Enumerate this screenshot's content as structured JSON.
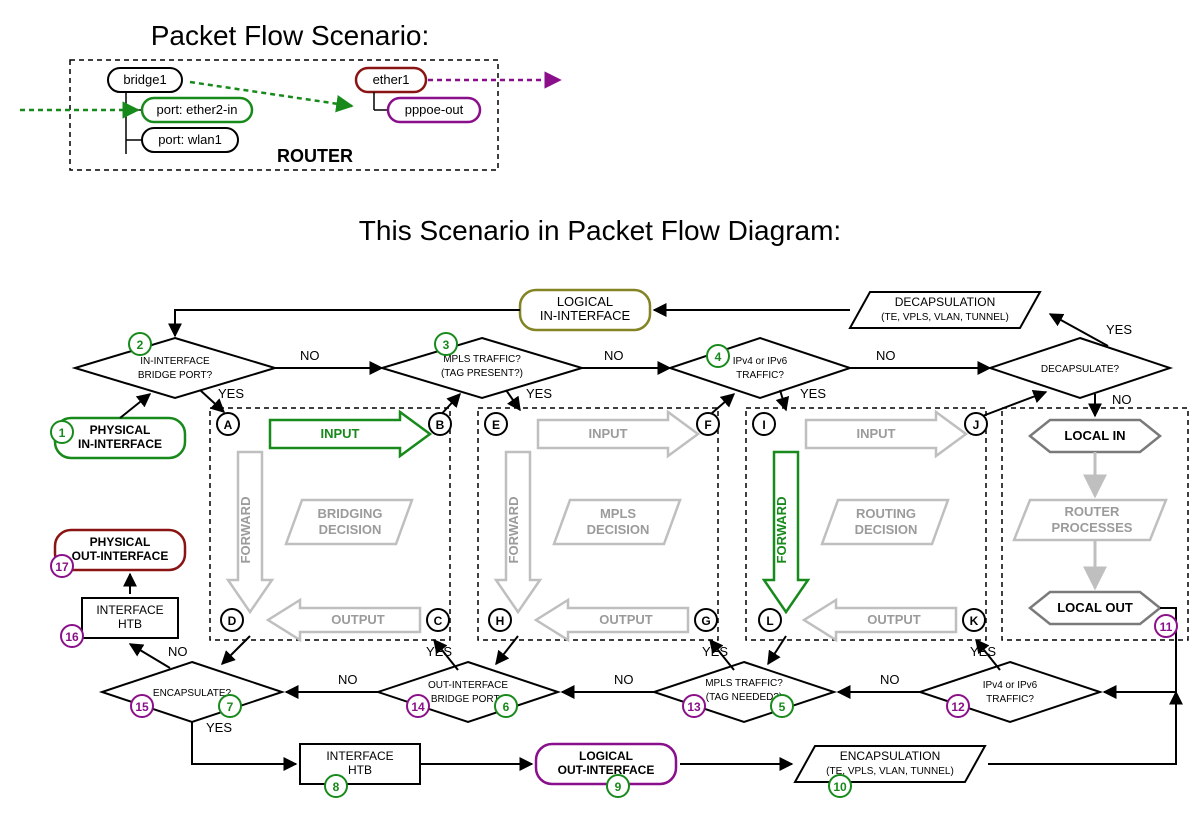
{
  "top_title": "Packet Flow Scenario:",
  "main_title": "This Scenario in Packet Flow Diagram:",
  "router_label": "ROUTER",
  "scenario": {
    "bridge": "bridge1",
    "p1": "port: ether2-in",
    "p2": "port: wlan1",
    "e1": "ether1",
    "pppoe": "pppoe-out"
  },
  "nodes": {
    "phys_in": "PHYSICAL\nIN-INTERFACE",
    "log_in": "LOGICAL\nIN-INTERFACE",
    "decap": "DECAPSULATION\n(TE, VPLS, VLAN, TUNNEL)",
    "d1": "IN-INTERFACE\nBRIDGE PORT?",
    "d2": "MPLS TRAFFIC?",
    "d2s": "(TAG PRESENT?)",
    "d3": "IPv4 or IPv6\nTRAFFIC?",
    "d4": "DECAPSULATE?",
    "bridging": "BRIDGING\nDECISION",
    "mpls": "MPLS\nDECISION",
    "routing": "ROUTING\nDECISION",
    "input": "INPUT",
    "forward": "FORWARD",
    "output": "OUTPUT",
    "local_in": "LOCAL IN",
    "router_proc": "ROUTER\nPROCESSES",
    "local_out": "LOCAL OUT",
    "d5": "IPv4 or IPv6\nTRAFFIC?",
    "d6": "MPLS TRAFFIC?",
    "d6s": "(TAG NEEDED?)",
    "d7": "OUT-INTERFACE\nBRIDGE PORT?",
    "d8": "ENCAPSULATE?",
    "encap": "ENCAPSULATION\n(TE, VPLS, VLAN, TUNNEL)",
    "htb": "INTERFACE\nHTB",
    "htb2": "INTERFACE\nHTB",
    "log_out": "LOGICAL\nOUT-INTERFACE",
    "phys_out": "PHYSICAL\nOUT-INTERFACE"
  },
  "yes": "YES",
  "no": "NO",
  "letters": [
    "A",
    "B",
    "C",
    "D",
    "E",
    "F",
    "G",
    "H",
    "I",
    "J",
    "K",
    "L"
  ],
  "nums": [
    "1",
    "2",
    "3",
    "4",
    "5",
    "6",
    "7",
    "8",
    "9",
    "10",
    "11",
    "12",
    "13",
    "14",
    "15",
    "16",
    "17"
  ]
}
